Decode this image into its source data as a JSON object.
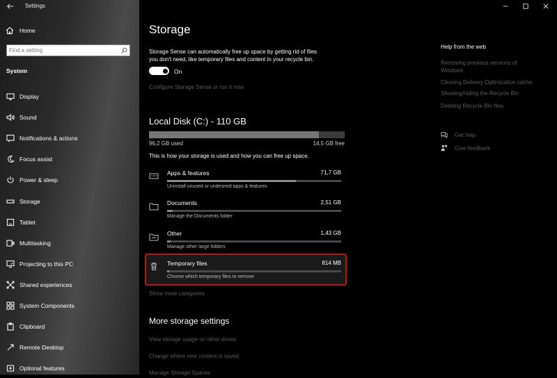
{
  "window": {
    "title": "Settings"
  },
  "sidebar": {
    "home_label": "Home",
    "search_placeholder": "Find a setting",
    "section_title": "System",
    "items": [
      {
        "label": "Display",
        "icon": "display-icon"
      },
      {
        "label": "Sound",
        "icon": "speaker-icon"
      },
      {
        "label": "Notifications & actions",
        "icon": "notification-icon"
      },
      {
        "label": "Focus assist",
        "icon": "moon-icon"
      },
      {
        "label": "Power & sleep",
        "icon": "power-icon"
      },
      {
        "label": "Storage",
        "icon": "storage-icon",
        "selected": true
      },
      {
        "label": "Tablet",
        "icon": "tablet-icon"
      },
      {
        "label": "Multitasking",
        "icon": "multitasking-icon"
      },
      {
        "label": "Projecting to this PC",
        "icon": "projecting-icon"
      },
      {
        "label": "Shared experiences",
        "icon": "shared-experiences-icon"
      },
      {
        "label": "System Components",
        "icon": "components-icon"
      },
      {
        "label": "Clipboard",
        "icon": "clipboard-icon"
      },
      {
        "label": "Remote Desktop",
        "icon": "remote-desktop-icon"
      },
      {
        "label": "Optional features",
        "icon": "optional-features-icon"
      }
    ]
  },
  "main": {
    "title": "Storage",
    "sense_description_line1": "Storage Sense can automatically free up space by getting rid of files",
    "sense_description_line2": "you don't need, like temporary files and content in your recycle bin.",
    "toggle_label": "On",
    "toggle_on": true,
    "configure_link": "Configure Storage Sense or run it now",
    "disk_title": "Local Disk (C:) - 110 GB",
    "disk_used": "96,2 GB used",
    "disk_free": "14,5 GB free",
    "disk_used_fraction": 0.87,
    "usage_intro": "This is how your storage is used and how you can free up space.",
    "categories": [
      {
        "label": "Apps & features",
        "size": "71,7 GB",
        "sub": "Uninstall unused or undesired apps & features",
        "icon": "apps-icon",
        "fraction": 0.74
      },
      {
        "label": "Documents",
        "size": "2,51 GB",
        "sub": "Manage the Documents folder",
        "icon": "documents-icon",
        "fraction": 0.03
      },
      {
        "label": "Other",
        "size": "1,43 GB",
        "sub": "Manage other large folders",
        "icon": "other-icon",
        "fraction": 0.02
      },
      {
        "label": "Temporary files",
        "size": "814 MB",
        "sub": "Choose which temporary files to remove",
        "icon": "trash-icon",
        "fraction": 0.01,
        "highlighted": true
      }
    ],
    "show_more": "Show more categories",
    "more_title": "More storage settings",
    "more_links": [
      "View storage usage on other drives",
      "Change where new content is saved",
      "Manage Storage Spaces"
    ]
  },
  "help": {
    "title": "Help from the web",
    "links": [
      "Removing previous versions of",
      "Windows",
      "Clearing Delivery Optimization cache",
      "Showing/hiding the Recycle Bin",
      "Deleting Recycle Bin files"
    ],
    "get_help": "Get help",
    "give_feedback": "Give feedback"
  },
  "colors": {
    "highlight_border": "#c0121b",
    "accent": "#ffffff"
  }
}
